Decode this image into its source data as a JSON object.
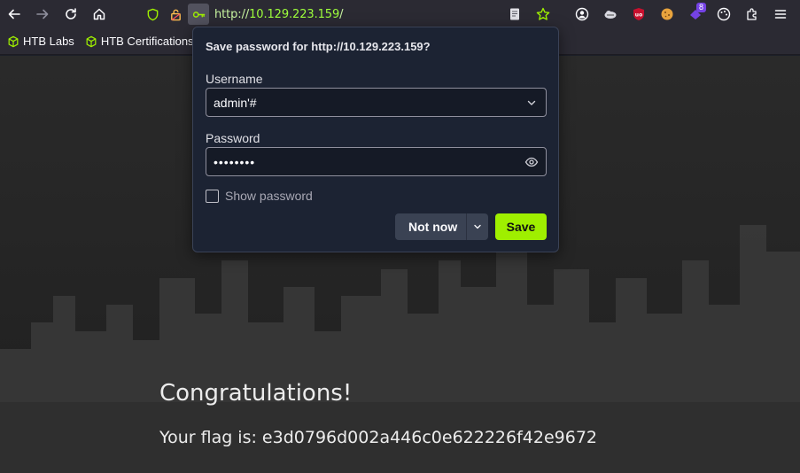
{
  "browser": {
    "url_scheme": "http://",
    "url_host": "10.129.223.159",
    "url_path": "/",
    "extension_badge": "8"
  },
  "bookmarks": [
    {
      "label": "HTB Labs"
    },
    {
      "label": "HTB Certifications"
    }
  ],
  "popup": {
    "title": "Save password for http://10.129.223.159?",
    "username_label": "Username",
    "username_value": "admin'#",
    "password_label": "Password",
    "password_value": "••••••••",
    "show_password_label": "Show password",
    "not_now_label": "Not now",
    "save_label": "Save"
  },
  "page": {
    "heading": "Congratulations!",
    "flag_text": "Your flag is: e3d0796d002a446c0e622226f42e9672"
  },
  "colors": {
    "accent": "#9fef00",
    "popup_bg": "#1c2333",
    "toolbar_bg": "#2b2a33"
  }
}
